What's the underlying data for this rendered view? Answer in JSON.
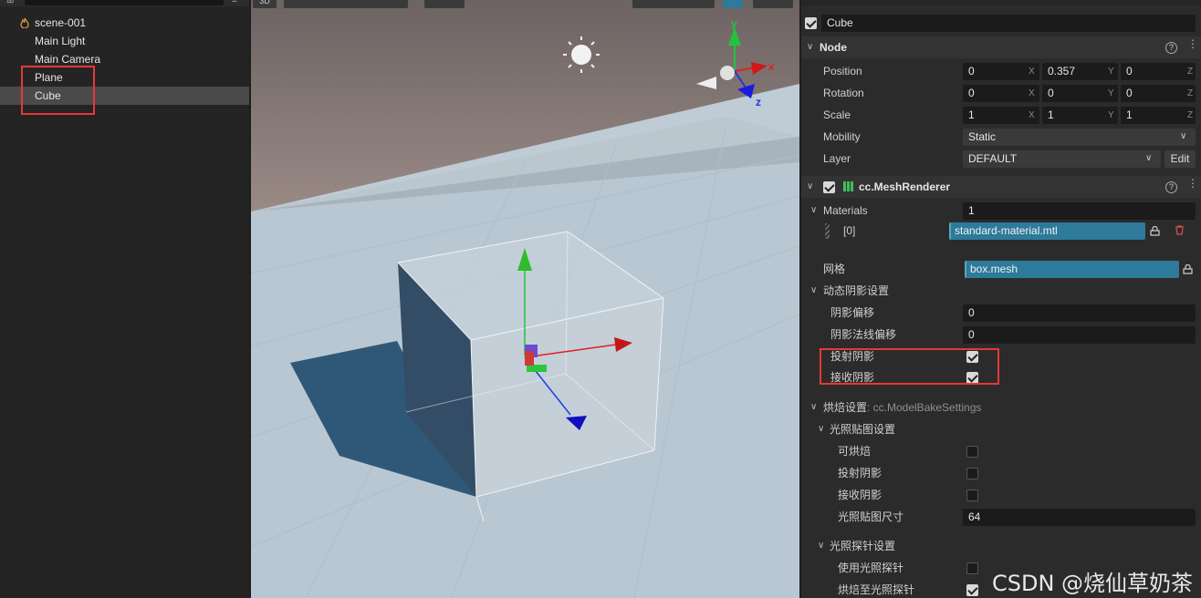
{
  "hierarchy": {
    "scene_label": "scene-001",
    "items": [
      {
        "label": "Main Light"
      },
      {
        "label": "Main Camera"
      },
      {
        "label": "Plane"
      },
      {
        "label": "Cube"
      }
    ]
  },
  "viewport": {
    "mode_label": "3D",
    "gizmo_labels": {
      "x": "x",
      "y": "y",
      "z": "z"
    }
  },
  "inspector": {
    "node_name": "Cube",
    "node_section": "Node",
    "position": {
      "label": "Position",
      "x": "0",
      "y": "0.357",
      "z": "0"
    },
    "rotation": {
      "label": "Rotation",
      "x": "0",
      "y": "0",
      "z": "0"
    },
    "scale": {
      "label": "Scale",
      "x": "1",
      "y": "1",
      "z": "1"
    },
    "axis_labels": {
      "x": "X",
      "y": "Y",
      "z": "Z"
    },
    "mobility": {
      "label": "Mobility",
      "value": "Static"
    },
    "layer": {
      "label": "Layer",
      "value": "DEFAULT",
      "edit_label": "Edit"
    },
    "mesh_renderer": {
      "title": "cc.MeshRenderer",
      "materials_label": "Materials",
      "materials_count": "1",
      "material_index": "[0]",
      "material_value": "standard-material.mtl",
      "mesh_label": "网格",
      "mesh_value": "box.mesh",
      "shadow_group": "动态阴影设置",
      "shadow_bias_label": "阴影偏移",
      "shadow_bias_value": "0",
      "shadow_normal_bias_label": "阴影法线偏移",
      "shadow_normal_bias_value": "0",
      "cast_shadow_label": "投射阴影",
      "cast_shadow": true,
      "receive_shadow_label": "接收阴影",
      "receive_shadow": true,
      "bake_group": "烘焙设置",
      "bake_group_type": " : cc.ModelBakeSettings",
      "lightmap_group": "光照贴图设置",
      "bakeable_label": "可烘焙",
      "bakeable": false,
      "lm_cast_label": "投射阴影",
      "lm_cast": false,
      "lm_receive_label": "接收阴影",
      "lm_receive": false,
      "lm_size_label": "光照贴图尺寸",
      "lm_size_value": "64",
      "probe_group": "光照探针设置",
      "use_probe_label": "使用光照探针",
      "use_probe": false,
      "bake_to_probe_label": "烘焙至光照探针",
      "bake_to_probe": true
    }
  },
  "watermark": "CSDN @烧仙草奶茶",
  "colors": {
    "accent": "#2d7a9a",
    "highlight_box": "#e53935",
    "panel": "#2b2b2b"
  }
}
